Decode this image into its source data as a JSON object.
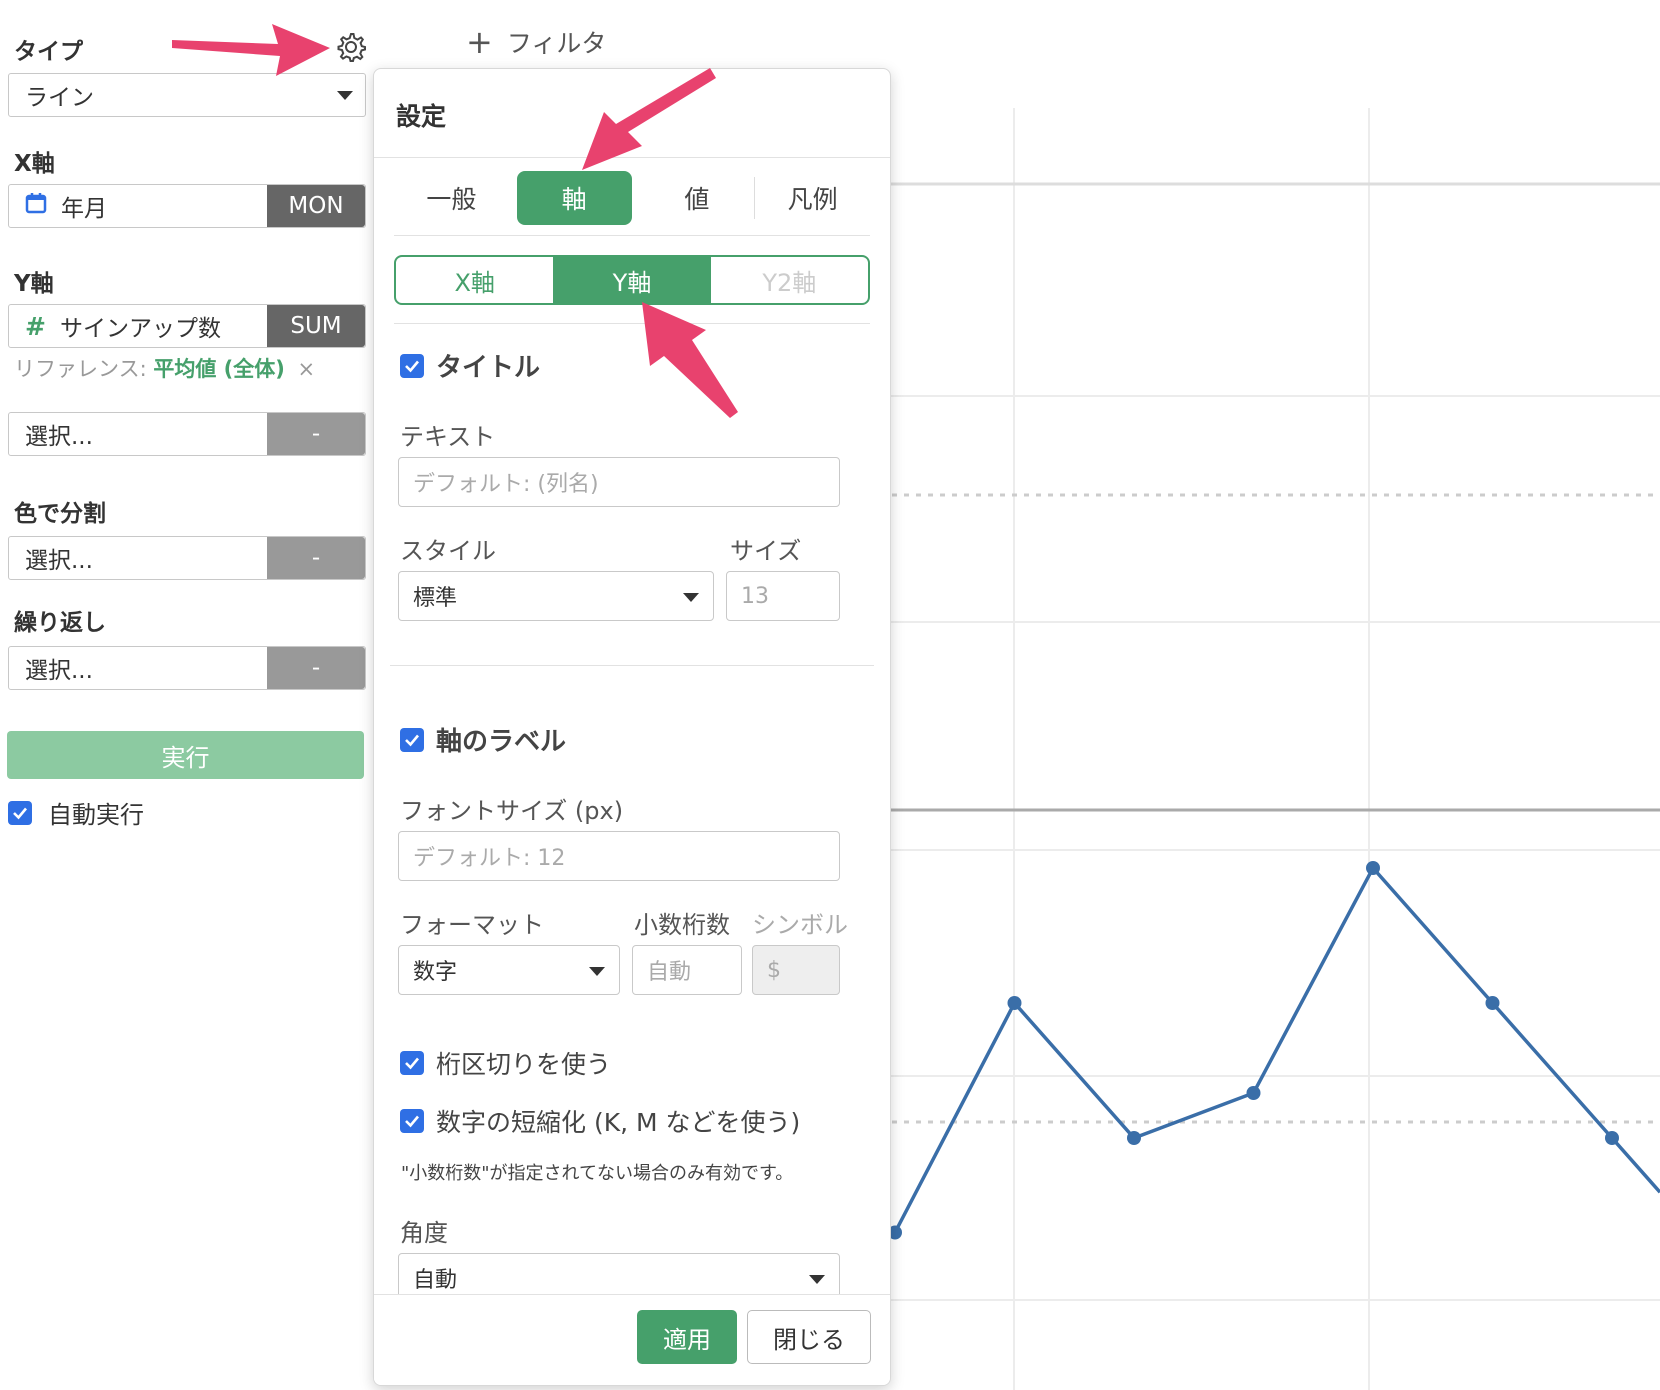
{
  "left_panel": {
    "type_label": "タイプ",
    "type_value": "ライン",
    "x_label": "X軸",
    "x_field": "年月",
    "x_agg": "MON",
    "y_label": "Y軸",
    "y_field": "サインアップ数",
    "y_agg": "SUM",
    "reference_prefix": "リファレンス:",
    "reference_value": "平均値 (全体)",
    "reference_remove": "×",
    "extra_select": "選択...",
    "extra_agg": "-",
    "color_label": "色で分割",
    "color_select": "選択...",
    "color_agg": "-",
    "repeat_label": "繰り返し",
    "repeat_select": "選択...",
    "repeat_agg": "-",
    "run_label": "実行",
    "auto_run_label": "自動実行"
  },
  "toolbar": {
    "filter_label": "フィルタ",
    "filter_plus": "+"
  },
  "settings": {
    "title": "設定",
    "tabs": [
      "一般",
      "軸",
      "値",
      "凡例"
    ],
    "active_tab": "軸",
    "axis_tabs": [
      "X軸",
      "Y軸",
      "Y2軸"
    ],
    "active_axis": "Y軸",
    "title_section": "タイトル",
    "text_label": "テキスト",
    "text_placeholder": "デフォルト: (列名)",
    "style_label": "スタイル",
    "style_value": "標準",
    "size_label": "サイズ",
    "size_value": "13",
    "axis_label_section": "軸のラベル",
    "font_size_label": "フォントサイズ (px)",
    "font_size_placeholder": "デフォルト: 12",
    "format_label": "フォーマット",
    "format_value": "数字",
    "decimals_label": "小数桁数",
    "decimals_placeholder": "自動",
    "symbol_label": "シンボル",
    "symbol_placeholder": "$",
    "thousands_sep": "桁区切りを使う",
    "abbreviate": "数字の短縮化 (K, M などを使う)",
    "note": "\"小数桁数\"が指定されてない場合のみ有効です。",
    "angle_label": "角度",
    "angle_value": "自動",
    "apply_label": "適用",
    "close_label": "閉じる"
  },
  "colors": {
    "accent": "#46a06b",
    "line": "#3a6ea8",
    "arrow": "#e8426e",
    "checkbox": "#2f6fe4"
  },
  "chart_data": {
    "type": "line",
    "series": [
      {
        "values": [
          0.15,
          0.66,
          0.36,
          0.46,
          0.96,
          0.66,
          0.36
        ]
      }
    ]
  }
}
